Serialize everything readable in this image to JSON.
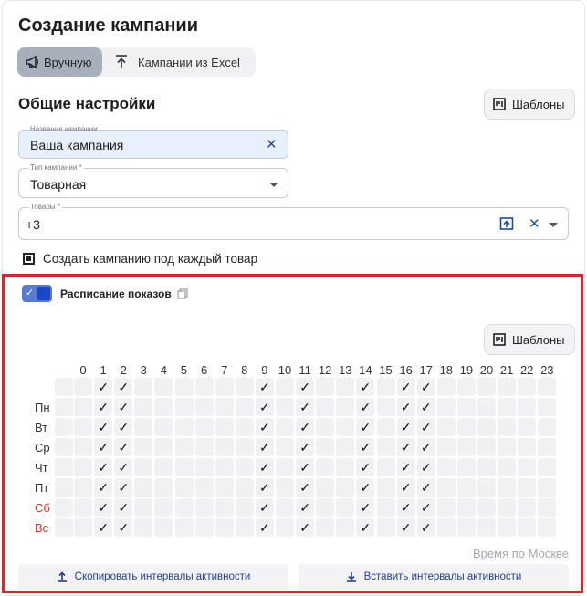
{
  "page": {
    "title": "Создание кампании"
  },
  "mode_toggle": {
    "manual_label": "Вручную",
    "excel_label": "Кампании из Excel",
    "active": "manual"
  },
  "general": {
    "title": "Общие настройки",
    "templates_label": "Шаблоны",
    "campaign_name": {
      "label": "Название кампании",
      "value": "Ваша кампания"
    },
    "campaign_type": {
      "label": "Тип кампании *",
      "value": "Товарная"
    },
    "products": {
      "label": "Товары *",
      "value": "+3"
    },
    "per_product_checkbox": {
      "label": "Создать кампанию под каждый товар",
      "checked": true
    }
  },
  "schedule": {
    "enabled": true,
    "label": "Расписание показов",
    "templates_label": "Шаблоны",
    "hours": [
      "0",
      "1",
      "2",
      "3",
      "4",
      "5",
      "6",
      "7",
      "8",
      "9",
      "10",
      "11",
      "12",
      "13",
      "14",
      "15",
      "16",
      "17",
      "18",
      "19",
      "20",
      "21",
      "22",
      "23"
    ],
    "days": [
      {
        "label": "Пн",
        "weekend": false
      },
      {
        "label": "Вт",
        "weekend": false
      },
      {
        "label": "Ср",
        "weekend": false
      },
      {
        "label": "Чт",
        "weekend": false
      },
      {
        "label": "Пт",
        "weekend": false
      },
      {
        "label": "Сб",
        "weekend": true
      },
      {
        "label": "Вс",
        "weekend": true
      }
    ],
    "header_checked_hours": [
      1,
      2,
      9,
      11,
      14,
      16,
      17
    ],
    "active_hours": [
      1,
      2,
      9,
      11,
      14,
      16,
      17
    ],
    "timezone_note": "Время по Москве",
    "copy_label": "Скопировать интервалы активности",
    "paste_label": "Вставить интервалы активности"
  },
  "colors": {
    "accent": "#1848c6",
    "highlight_border": "#d9252f",
    "weekend": "#c0392b"
  }
}
